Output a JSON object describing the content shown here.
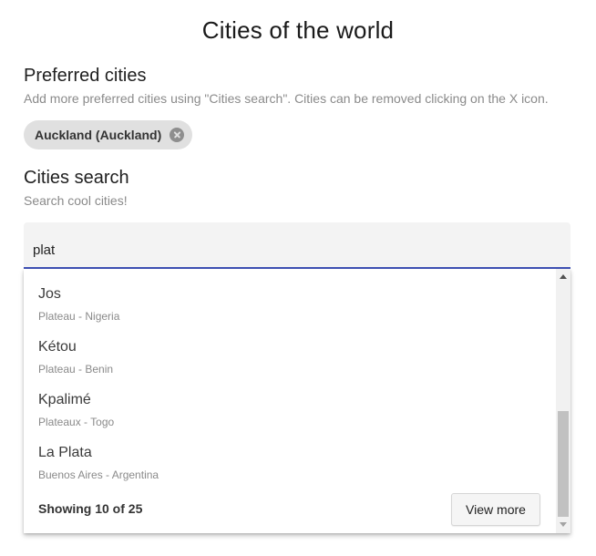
{
  "header": {
    "title": "Cities of the world"
  },
  "preferred": {
    "title": "Preferred cities",
    "description": "Add more preferred cities using \"Cities search\". Cities can be removed clicking on the X icon.",
    "chips": [
      {
        "label": "Auckland (Auckland)",
        "remove_icon": "close-circle-icon"
      }
    ]
  },
  "search": {
    "title": "Cities search",
    "description": "Search cool cities!",
    "value": "plat",
    "accent_color": "#3f51b5"
  },
  "results": {
    "items": [
      {
        "name": "Jos",
        "region": "Plateau - Nigeria"
      },
      {
        "name": "Kétou",
        "region": "Plateau - Benin"
      },
      {
        "name": "Kpalimé",
        "region": "Plateaux - Togo"
      },
      {
        "name": "La Plata",
        "region": "Buenos Aires - Argentina"
      }
    ],
    "count_text": "Showing 10 of 25",
    "view_more_label": "View more"
  }
}
